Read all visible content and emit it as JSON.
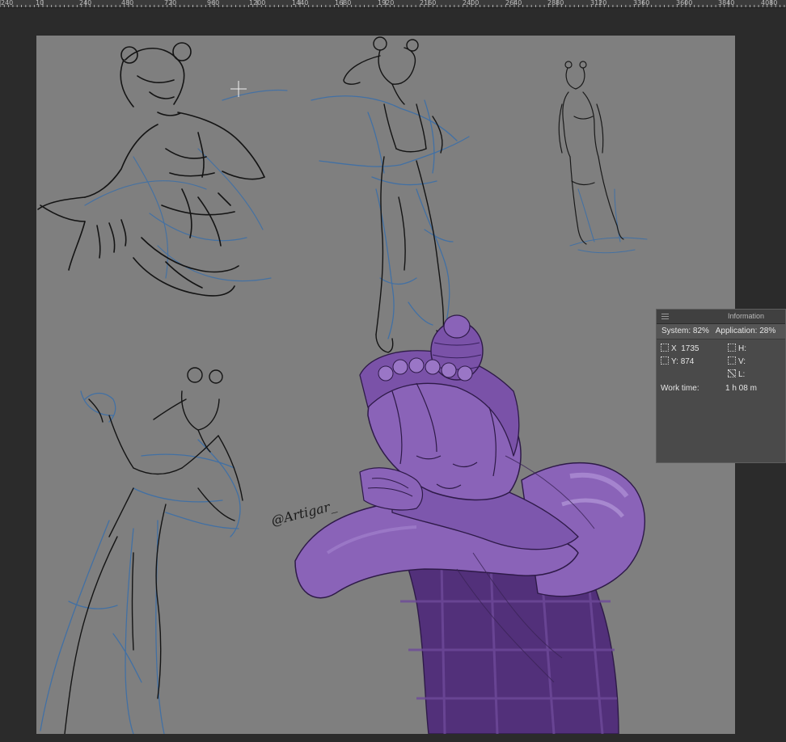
{
  "ruler": {
    "labels": [
      "240",
      "10",
      "240",
      "480",
      "720",
      "960",
      "1200",
      "1440",
      "1680",
      "1920",
      "2160",
      "2400",
      "2640",
      "2880",
      "3120",
      "3360",
      "3600",
      "3840",
      "4080"
    ]
  },
  "canvas": {
    "background": "#7f7f7f",
    "signature": "@Artigar_"
  },
  "info_panel": {
    "title": "Information",
    "system_label": "System:",
    "system_value": "82%",
    "application_label": "Application:",
    "application_value": "28%",
    "x_label": "X",
    "x_value": "1735",
    "y_label": "Y:",
    "y_value": "874",
    "h_label": "H:",
    "v_label": "V:",
    "l_label": "L:",
    "work_time_label": "Work time:",
    "work_time_value": "1 h 08 m"
  },
  "colors": {
    "sketch_black": "#141414",
    "sketch_blue": "#3c6fa8",
    "purple": "#8a63b8",
    "purple_dark": "#52307a"
  }
}
